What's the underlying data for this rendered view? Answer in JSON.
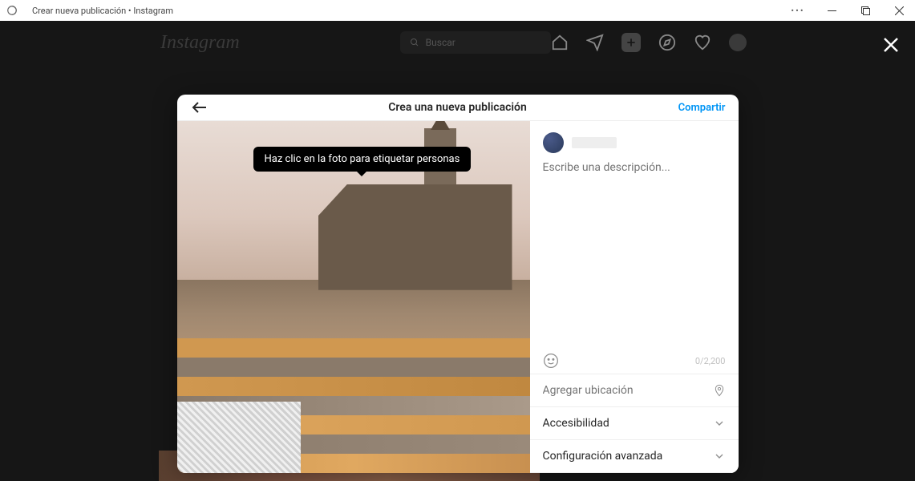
{
  "titlebar": {
    "title": "Crear nueva publicación • Instagram"
  },
  "topbar": {
    "logo": "Instagram",
    "search_placeholder": "Buscar"
  },
  "modal": {
    "title": "Crea una nueva publicación",
    "share_label": "Compartir",
    "tooltip": "Haz clic en la foto para etiquetar personas",
    "caption_placeholder": "Escribe una descripción...",
    "char_count": "0/2,200",
    "location_placeholder": "Agregar ubicación",
    "accessibility_label": "Accesibilidad",
    "advanced_label": "Configuración avanzada"
  }
}
